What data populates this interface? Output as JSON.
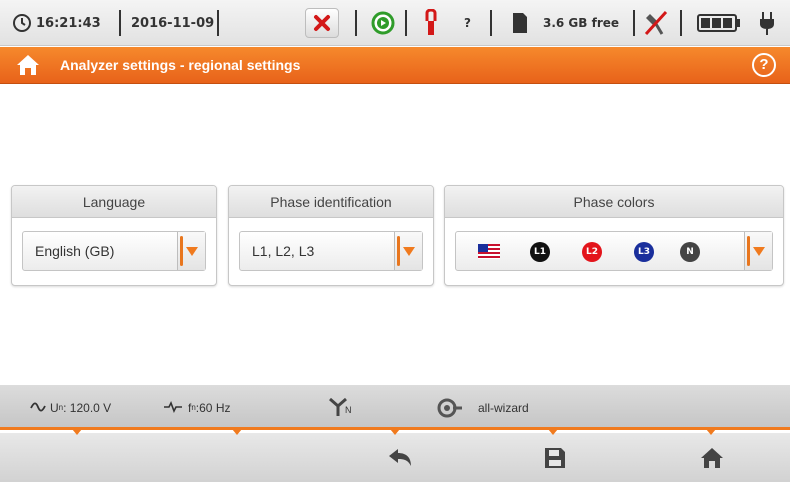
{
  "status_bar": {
    "time": "16:21:43",
    "date": "2016-11-09",
    "clamp_help": "?",
    "free_space": "3.6 GB free",
    "icons": [
      "clock-icon",
      "stop-icon",
      "play-icon",
      "clamp-icon",
      "sd-card-icon",
      "gps-off-icon",
      "battery-icon",
      "plug-icon"
    ]
  },
  "title_bar": {
    "title": "Analyzer settings - regional settings",
    "help": "?"
  },
  "panels": {
    "language": {
      "header": "Language",
      "value": "English (GB)"
    },
    "phase_identification": {
      "header": "Phase identification",
      "value": "L1, L2, L3"
    },
    "phase_colors": {
      "header": "Phase colors",
      "phases": [
        {
          "label": "L1",
          "color": "#111111"
        },
        {
          "label": "L2",
          "color": "#e3141b"
        },
        {
          "label": "L3",
          "color": "#1a2f9c"
        },
        {
          "label": "N",
          "color": "#444444"
        }
      ]
    }
  },
  "info_bar": {
    "voltage_label": "U",
    "voltage_sub": "n",
    "voltage_value": ": 120.0 V",
    "freq_label": "f",
    "freq_sub": "n",
    "freq_value": ":60 Hz",
    "network_sub": "N",
    "wizard": "all-wizard"
  },
  "colors": {
    "accent": "#f07a1e",
    "title_bar": "#e8621a"
  },
  "bottom_buttons": [
    "back-icon",
    "save-icon",
    "home-icon"
  ]
}
